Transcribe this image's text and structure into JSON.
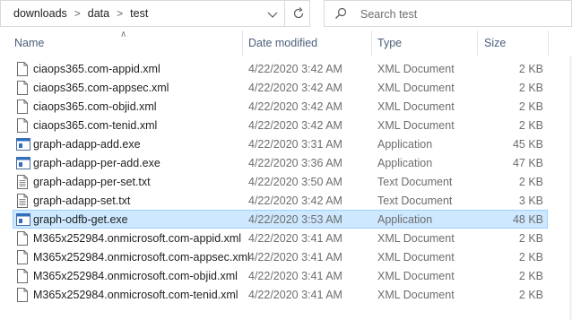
{
  "address": {
    "crumbs": [
      "downloads",
      "data",
      "test"
    ],
    "separator": ">"
  },
  "search": {
    "placeholder": "Search test"
  },
  "columns": {
    "name": "Name",
    "date": "Date modified",
    "type": "Type",
    "size": "Size"
  },
  "files": [
    {
      "name": "ciaops365.com-appid.xml",
      "date": "4/22/2020 3:42 AM",
      "type": "XML Document",
      "size": "2 KB",
      "icon": "document-icon"
    },
    {
      "name": "ciaops365.com-appsec.xml",
      "date": "4/22/2020 3:42 AM",
      "type": "XML Document",
      "size": "2 KB",
      "icon": "document-icon"
    },
    {
      "name": "ciaops365.com-objid.xml",
      "date": "4/22/2020 3:42 AM",
      "type": "XML Document",
      "size": "2 KB",
      "icon": "document-icon"
    },
    {
      "name": "ciaops365.com-tenid.xml",
      "date": "4/22/2020 3:42 AM",
      "type": "XML Document",
      "size": "2 KB",
      "icon": "document-icon"
    },
    {
      "name": "graph-adapp-add.exe",
      "date": "4/22/2020 3:31 AM",
      "type": "Application",
      "size": "45 KB",
      "icon": "application-icon"
    },
    {
      "name": "graph-adapp-per-add.exe",
      "date": "4/22/2020 3:36 AM",
      "type": "Application",
      "size": "47 KB",
      "icon": "application-icon"
    },
    {
      "name": "graph-adapp-per-set.txt",
      "date": "4/22/2020 3:50 AM",
      "type": "Text Document",
      "size": "2 KB",
      "icon": "text-file-icon"
    },
    {
      "name": "graph-adapp-set.txt",
      "date": "4/22/2020 3:42 AM",
      "type": "Text Document",
      "size": "3 KB",
      "icon": "text-file-icon"
    },
    {
      "name": "graph-odfb-get.exe",
      "date": "4/22/2020 3:53 AM",
      "type": "Application",
      "size": "48 KB",
      "icon": "application-icon",
      "selected": true
    },
    {
      "name": "M365x252984.onmicrosoft.com-appid.xml",
      "date": "4/22/2020 3:41 AM",
      "type": "XML Document",
      "size": "2 KB",
      "icon": "document-icon"
    },
    {
      "name": "M365x252984.onmicrosoft.com-appsec.xml",
      "date": "4/22/2020 3:41 AM",
      "type": "XML Document",
      "size": "2 KB",
      "icon": "document-icon"
    },
    {
      "name": "M365x252984.onmicrosoft.com-objid.xml",
      "date": "4/22/2020 3:41 AM",
      "type": "XML Document",
      "size": "2 KB",
      "icon": "document-icon"
    },
    {
      "name": "M365x252984.onmicrosoft.com-tenid.xml",
      "date": "4/22/2020 3:41 AM",
      "type": "XML Document",
      "size": "2 KB",
      "icon": "document-icon"
    }
  ],
  "colors": {
    "selection_bg": "#cde8ff",
    "selection_border": "#99d1ff",
    "header_text": "#4c607a"
  }
}
